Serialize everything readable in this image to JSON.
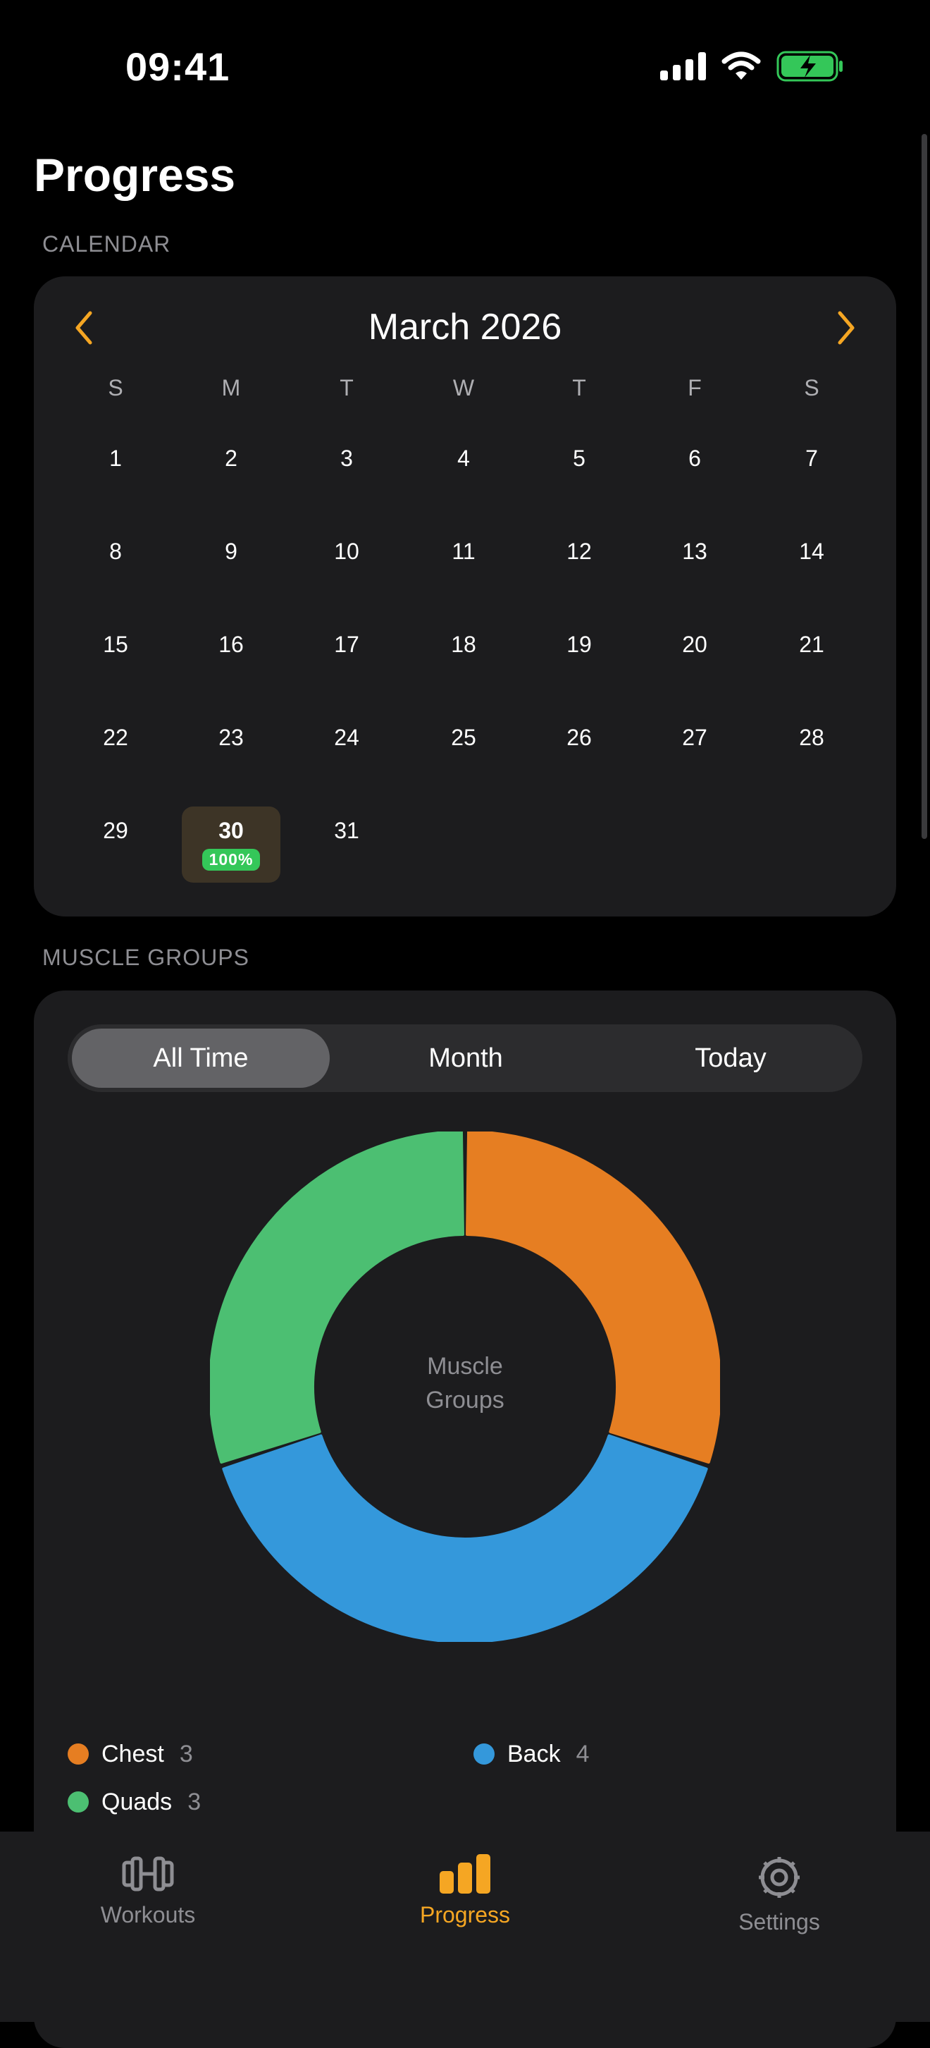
{
  "status_bar": {
    "time": "09:41",
    "signal_icon": "signal-icon",
    "wifi_icon": "wifi-icon",
    "battery_icon": "battery-charging-icon",
    "battery_color": "#34c759"
  },
  "page": {
    "title": "Progress"
  },
  "calendar": {
    "section_label": "CALENDAR",
    "month_title": "March 2026",
    "prev_icon": "chevron-left-icon",
    "next_icon": "chevron-right-icon",
    "weekdays": [
      "S",
      "M",
      "T",
      "W",
      "T",
      "F",
      "S"
    ],
    "days": [
      "1",
      "2",
      "3",
      "4",
      "5",
      "6",
      "7",
      "8",
      "9",
      "10",
      "11",
      "12",
      "13",
      "14",
      "15",
      "16",
      "17",
      "18",
      "19",
      "20",
      "21",
      "22",
      "23",
      "24",
      "25",
      "26",
      "27",
      "28",
      "29",
      "30",
      "31"
    ],
    "first_weekday_index": 0,
    "selected_day": "30",
    "selected_day_badge": "100%",
    "accent_color": "#f5a623"
  },
  "muscle_groups": {
    "section_label": "MUSCLE GROUPS",
    "segments": [
      "All Time",
      "Month",
      "Today"
    ],
    "active_segment": "All Time",
    "center_label_line1": "Muscle",
    "center_label_line2": "Groups",
    "legend": [
      {
        "name": "Chest",
        "count": "3",
        "color": "#e67e22"
      },
      {
        "name": "Back",
        "count": "4",
        "color": "#3498db"
      },
      {
        "name": "Quads",
        "count": "3",
        "color": "#4cbf72"
      }
    ]
  },
  "chart_data": {
    "type": "pie",
    "style": "donut",
    "title": "",
    "categories": [
      "Chest",
      "Back",
      "Quads"
    ],
    "values": [
      3,
      4,
      3
    ],
    "colors": [
      "#e67e22",
      "#3498db",
      "#4cbf72"
    ],
    "center_text": "Muscle Groups",
    "legend_position": "bottom"
  },
  "tab_bar": {
    "items": [
      {
        "label": "Workouts",
        "icon": "dumbbell-icon",
        "active": false
      },
      {
        "label": "Progress",
        "icon": "bar-chart-icon",
        "active": true
      },
      {
        "label": "Settings",
        "icon": "gear-icon",
        "active": false
      }
    ],
    "active_color": "#f5a623",
    "inactive_color": "#8e8e93"
  }
}
